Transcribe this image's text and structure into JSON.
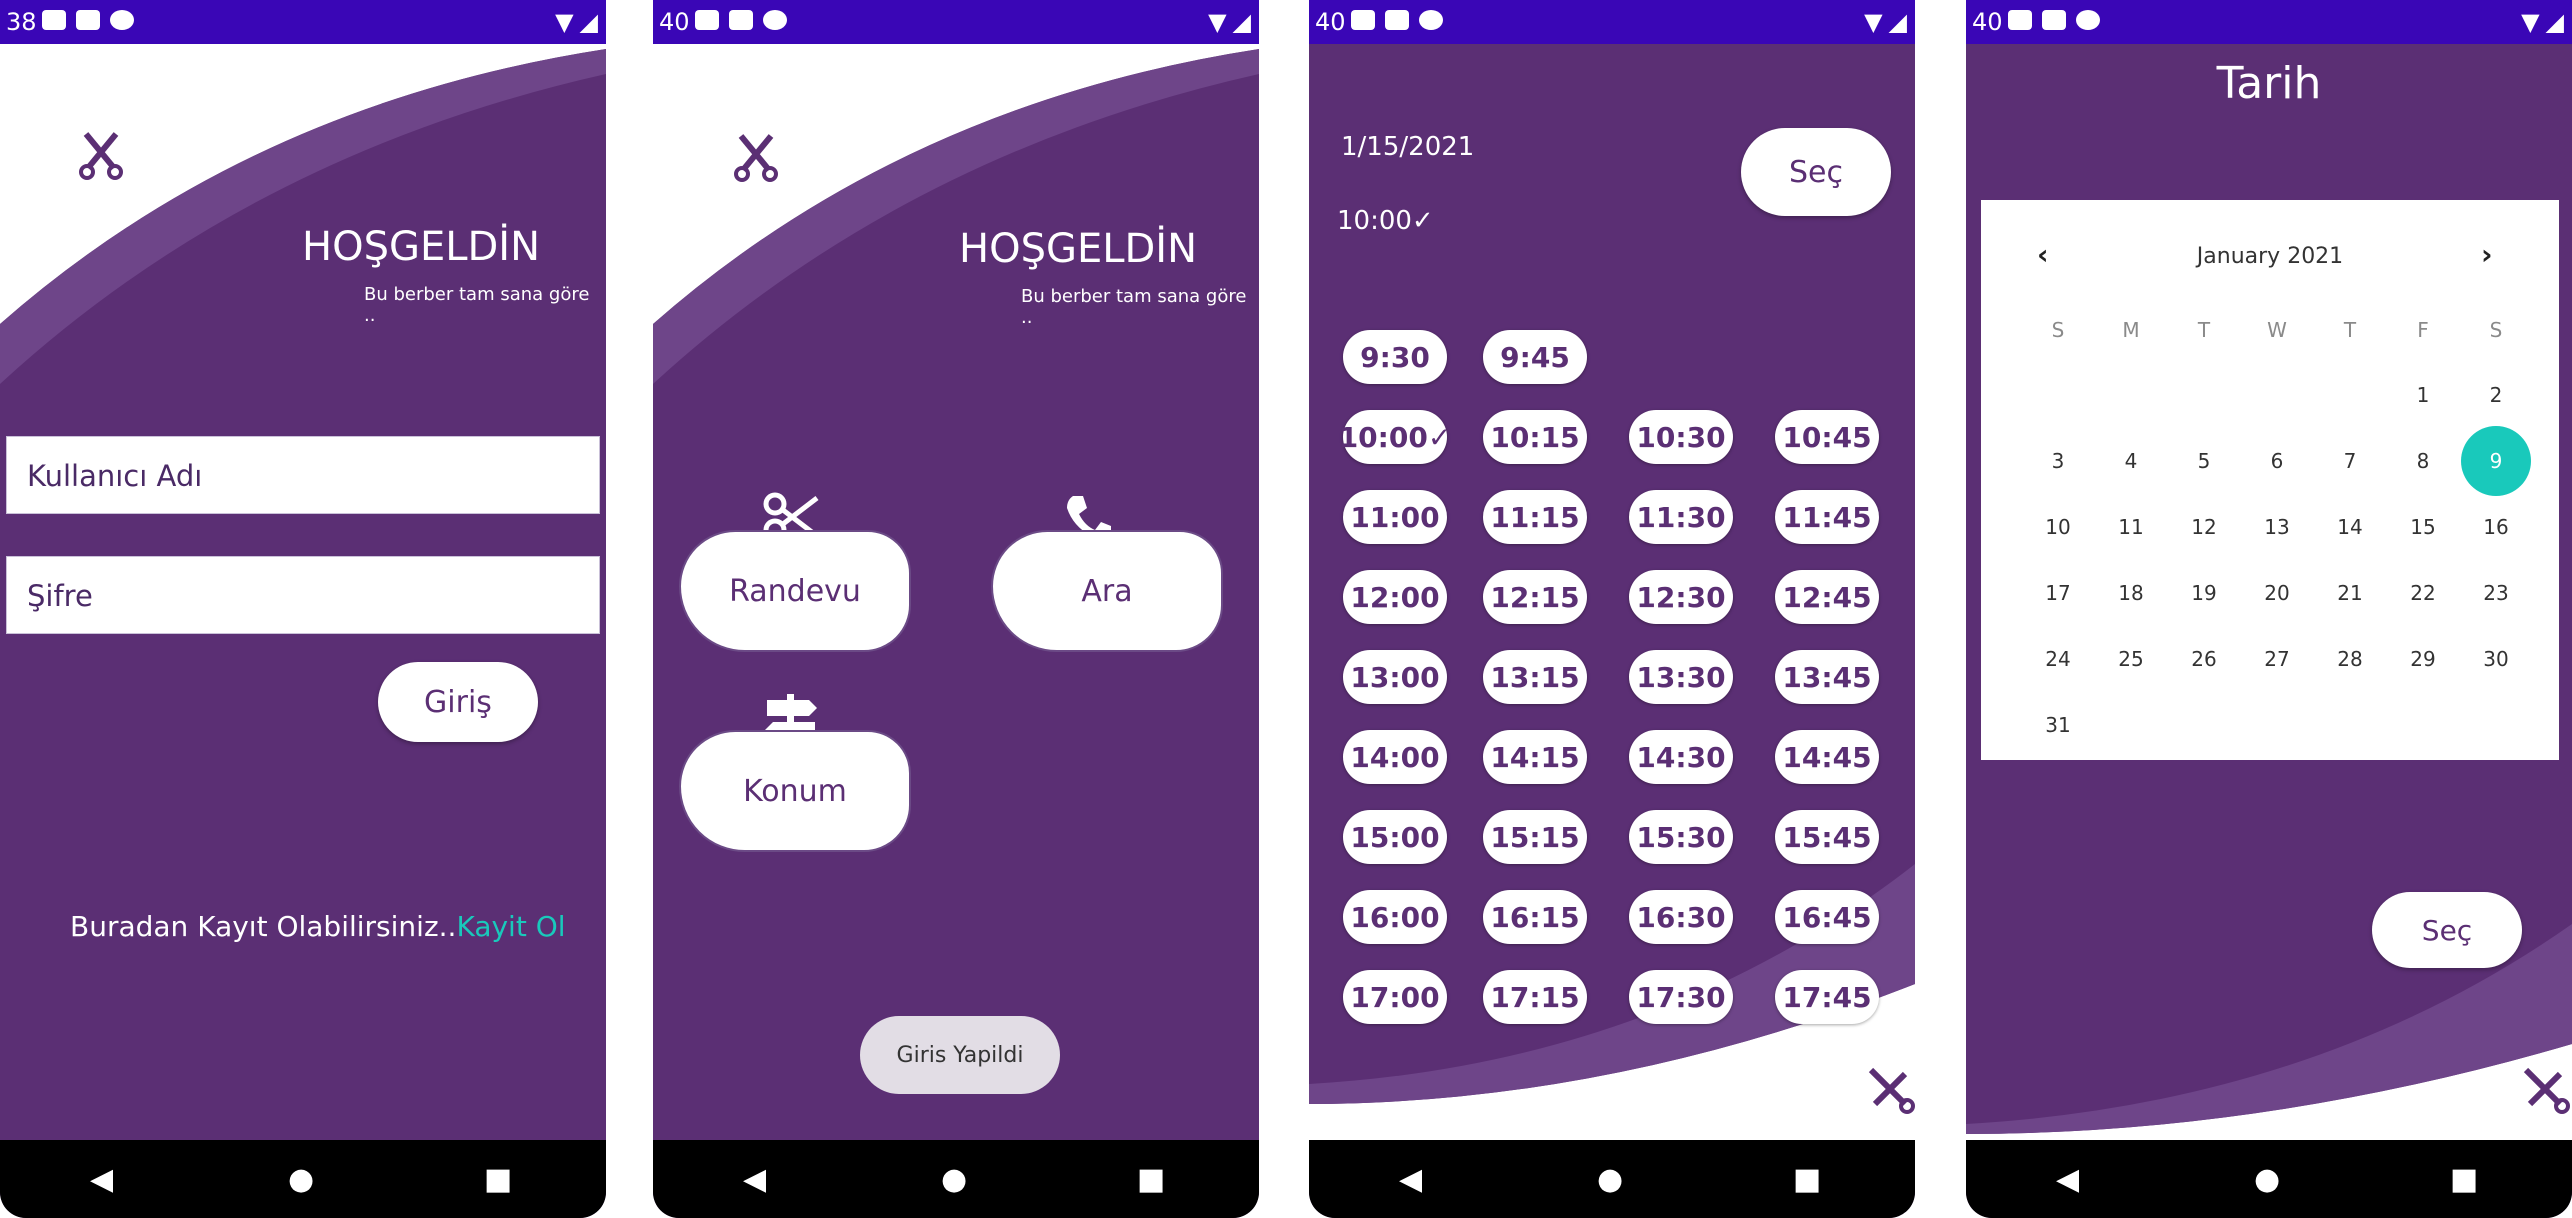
{
  "status_bar": {
    "screen1_time": "38",
    "screen2_time": "40",
    "screen3_time": "40",
    "screen4_time": "40"
  },
  "login": {
    "title": "HOŞGELDİN",
    "subtitle": "Bu berber tam sana göre ..",
    "username_placeholder": "Kullanıcı Adı",
    "password_placeholder": "Şifre",
    "login_button": "Giriş",
    "register_prompt": "Buradan Kayıt Olabilirsiniz..",
    "register_link": "Kayit Ol"
  },
  "home": {
    "title": "HOŞGELDİN",
    "subtitle": "Bu berber tam sana göre ..",
    "appointment_button": "Randevu",
    "call_button": "Ara",
    "location_button": "Konum",
    "toast": "Giris Yapildi"
  },
  "booking": {
    "selected_date": "1/15/2021",
    "selected_time": "10:00✓",
    "select_button": "Seç",
    "slots": [
      "9:30",
      "9:45",
      "10:00✓",
      "10:15",
      "10:30",
      "10:45",
      "11:00",
      "11:15",
      "11:30",
      "11:45",
      "12:00",
      "12:15",
      "12:30",
      "12:45",
      "13:00",
      "13:15",
      "13:30",
      "13:45",
      "14:00",
      "14:15",
      "14:30",
      "14:45",
      "15:00",
      "15:15",
      "15:30",
      "15:45",
      "16:00",
      "16:15",
      "16:30",
      "16:45",
      "17:00",
      "17:15",
      "17:30",
      "17:45"
    ]
  },
  "calendar": {
    "title": "Tarih",
    "month_label": "January 2021",
    "weekdays": [
      "S",
      "M",
      "T",
      "W",
      "T",
      "F",
      "S"
    ],
    "days": [
      "1",
      "2",
      "3",
      "4",
      "5",
      "6",
      "7",
      "8",
      "9",
      "10",
      "11",
      "12",
      "13",
      "14",
      "15",
      "16",
      "17",
      "18",
      "19",
      "20",
      "21",
      "22",
      "23",
      "24",
      "25",
      "26",
      "27",
      "28",
      "29",
      "30",
      "31"
    ],
    "selected_day": "9",
    "select_button": "Seç"
  },
  "colors": {
    "primary": "#5b2f74",
    "status_bar": "#3a06b6",
    "accent_link": "#19c9bb",
    "selected_day": "#19c9bb"
  }
}
